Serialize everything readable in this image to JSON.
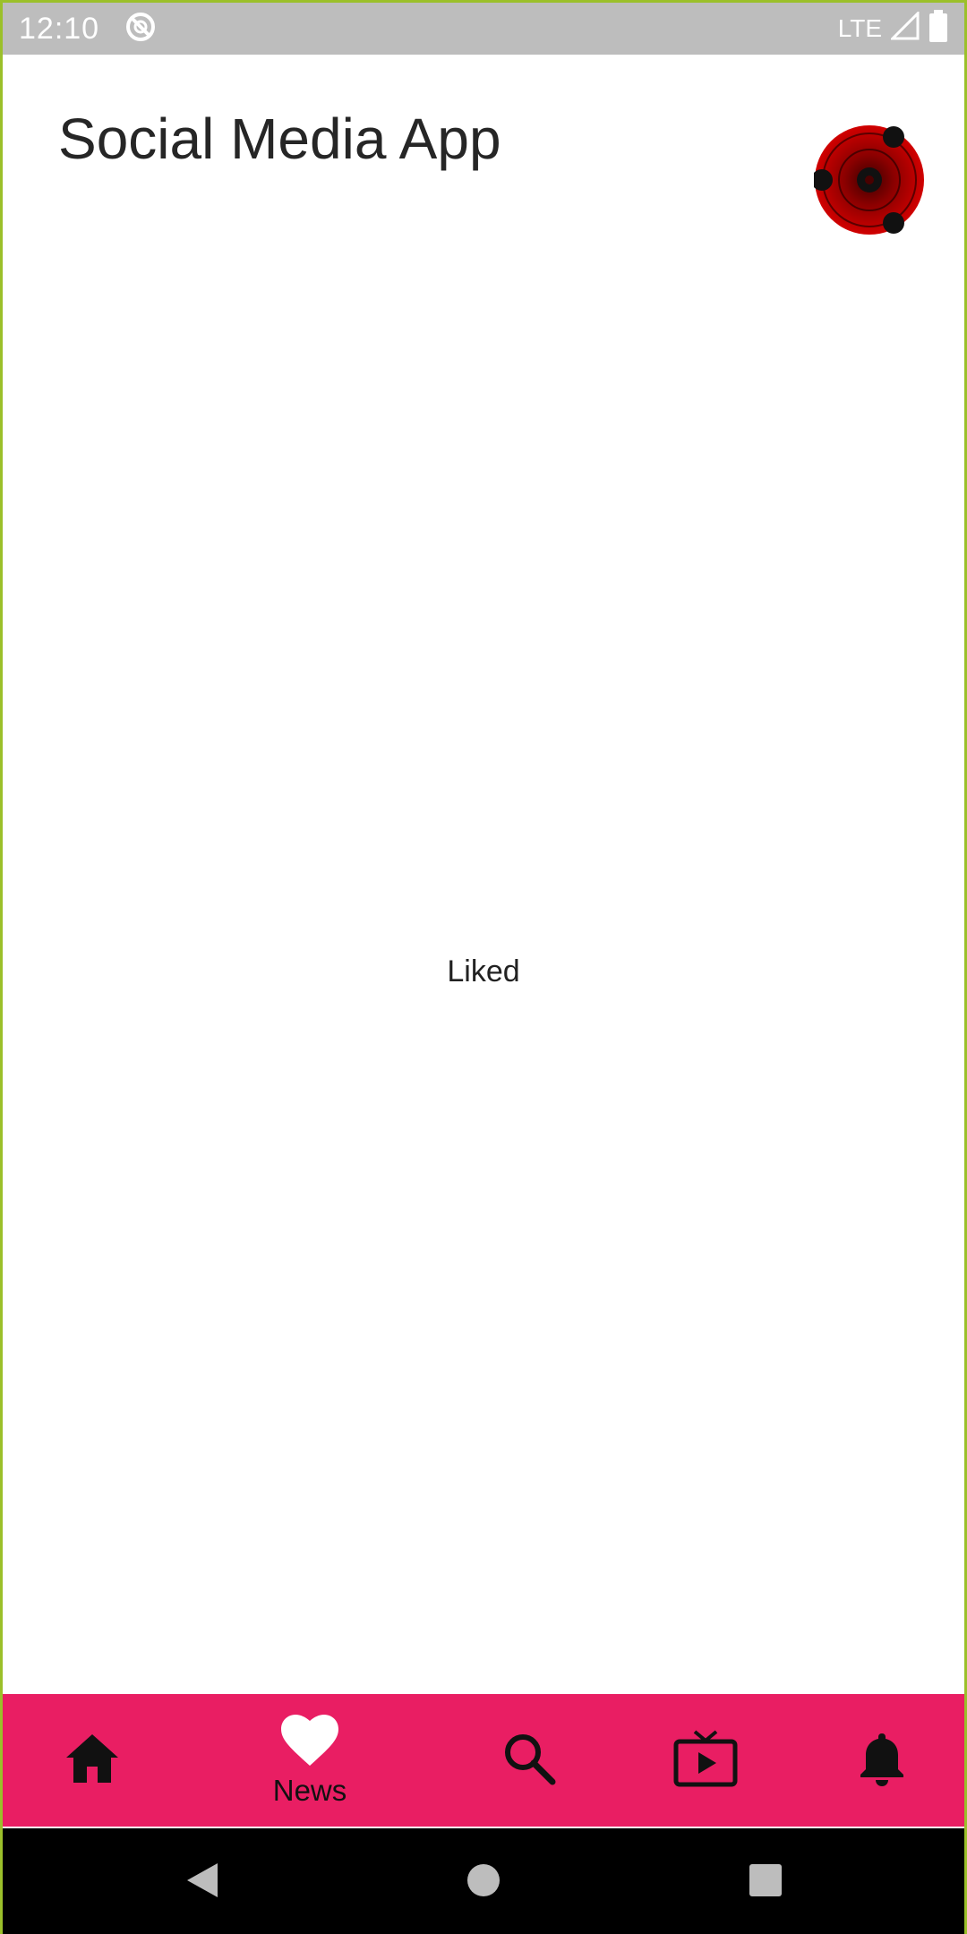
{
  "status_bar": {
    "time": "12:10",
    "network": "LTE",
    "icons": [
      "do-not-disturb-icon",
      "signal-icon",
      "battery-icon"
    ]
  },
  "header": {
    "title": "Social Media App",
    "avatar_icon": "sharingan-avatar-icon"
  },
  "main": {
    "content_text": "Liked"
  },
  "bottom_nav": {
    "background": "#e91e63",
    "icon_color": "#111111",
    "active_icon_color": "#ffffff",
    "items": [
      {
        "icon": "home-icon",
        "label": "",
        "active": false
      },
      {
        "icon": "heart-icon",
        "label": "News",
        "active": true
      },
      {
        "icon": "search-icon",
        "label": "",
        "active": false
      },
      {
        "icon": "tv-icon",
        "label": "",
        "active": false
      },
      {
        "icon": "bell-icon",
        "label": "",
        "active": false
      }
    ]
  },
  "system_nav": {
    "buttons": [
      "back-icon",
      "home-circle-icon",
      "recents-icon"
    ]
  },
  "colors": {
    "status_bar": "#bdbdbd",
    "accent": "#e91e63",
    "frame": "#9bc02a"
  }
}
